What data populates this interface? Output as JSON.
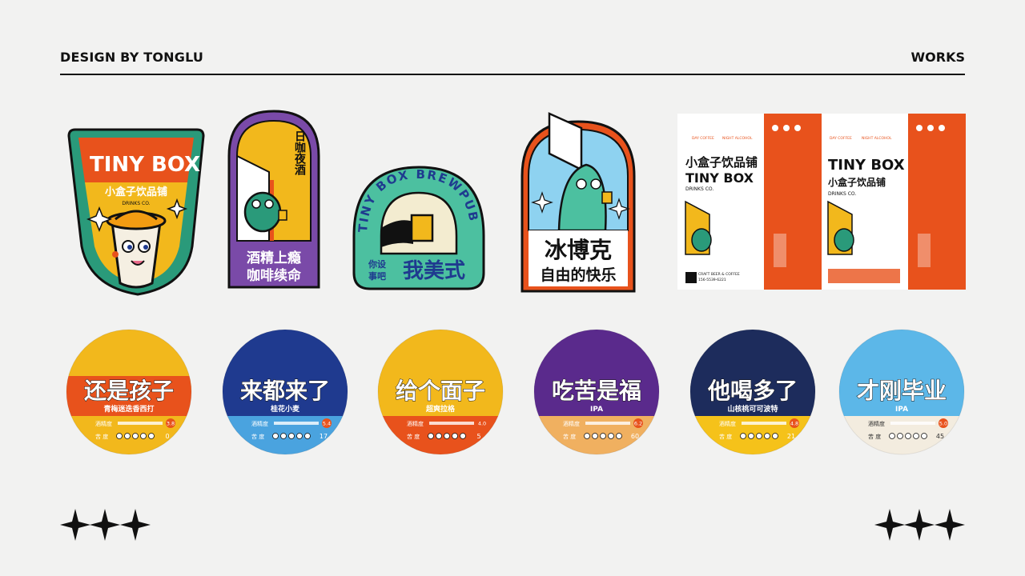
{
  "header": {
    "left": "DESIGN BY TONGLU",
    "right": "WORKS"
  },
  "stickers": {
    "shield": {
      "logo": "TINY BOX",
      "name": "小盒子饮品铺",
      "sub": "DRINKS CO."
    },
    "arch": {
      "vertical": "日咖夜酒",
      "line1": "酒精上瘾",
      "line2": "咖啡续命"
    },
    "badge": {
      "arc": "TINY BOX BREWPUB",
      "small1": "你设",
      "small2": "事吧",
      "big": "我美式"
    },
    "arch2": {
      "line1": "冰博克",
      "line2": "自由的快乐"
    }
  },
  "packaging": {
    "tagline_left": "DAY COFFEE",
    "tagline_right": "NIGHT ALCOHOL",
    "name": "小盒子饮品铺",
    "logo": "TINY BOX",
    "sub": "DRINKS CO.",
    "footer": "CRAFT BEER & COFFEE",
    "phone": "156-5539-6221"
  },
  "coasters": {
    "abv_label": "酒精度",
    "bitter_label": "苦 度",
    "items": [
      {
        "title": "还是孩子",
        "sub": "青梅迷迭香西打",
        "abv": "3.8",
        "bitter": "0",
        "top": "#f2b81c",
        "mid": "#e8521c",
        "bottom": "#f2b81c",
        "text": "#fff"
      },
      {
        "title": "来都来了",
        "sub": "桂花小麦",
        "abv": "5.4",
        "bitter": "17",
        "top": "#1f3a8f",
        "mid": "#1f3a8f",
        "bottom": "#4aa3df",
        "text": "#fff"
      },
      {
        "title": "给个面子",
        "sub": "超爽拉格",
        "abv": "4.0",
        "bitter": "5",
        "top": "#f2b81c",
        "mid": "#f2b81c",
        "bottom": "#e8521c",
        "text": "#fff"
      },
      {
        "title": "吃苦是福",
        "sub": "IPA",
        "abv": "6.2",
        "bitter": "60",
        "top": "#5a2a8c",
        "mid": "#5a2a8c",
        "bottom": "#f0b060",
        "text": "#fff"
      },
      {
        "title": "他喝多了",
        "sub": "山核桃可可波特",
        "abv": "4.8",
        "bitter": "21",
        "top": "#1d2c5c",
        "mid": "#1d2c5c",
        "bottom": "#f5c21a",
        "text": "#fff"
      },
      {
        "title": "才刚毕业",
        "sub": "IPA",
        "abv": "5.0",
        "bitter": "45",
        "top": "#5cb7e8",
        "mid": "#5cb7e8",
        "bottom": "#f3ecdf",
        "text": "#fff"
      }
    ]
  }
}
